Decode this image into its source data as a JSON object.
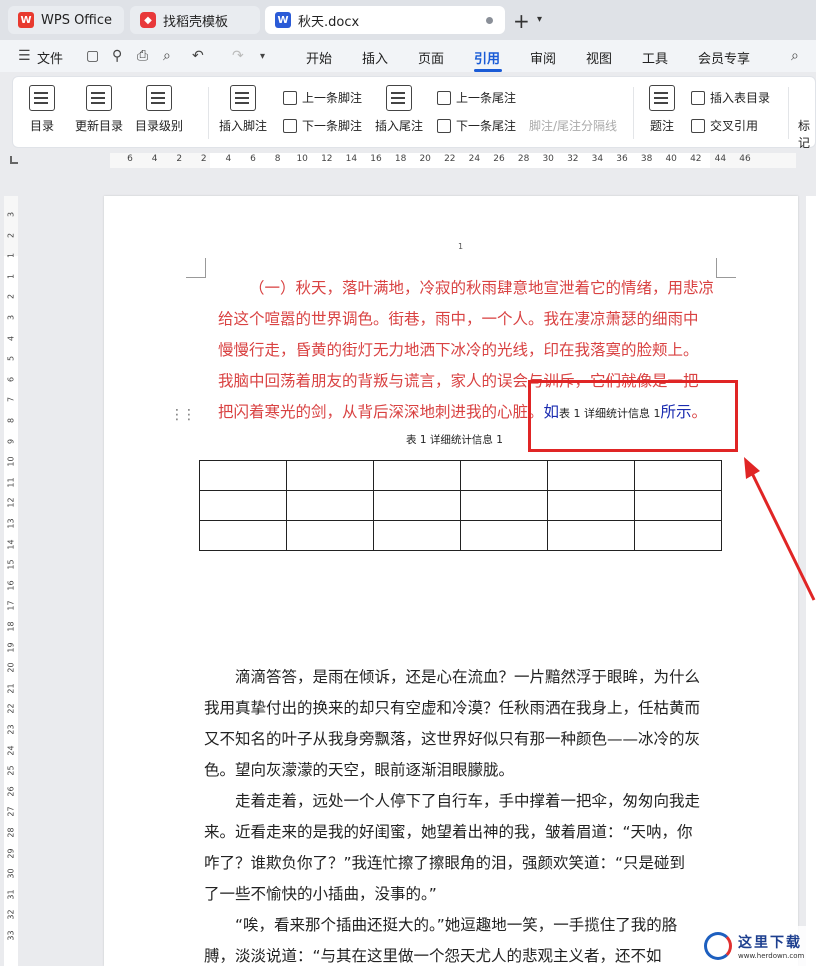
{
  "tabs": [
    {
      "label": "WPS Office",
      "icon": "wps-logo-icon"
    },
    {
      "label": "找稻壳模板",
      "icon": "daoke-logo-icon"
    },
    {
      "label": "秋天.docx",
      "icon": "word-doc-icon"
    }
  ],
  "menu": [
    "文件",
    "开始",
    "插入",
    "页面",
    "引用",
    "审阅",
    "视图",
    "工具",
    "会员专享"
  ],
  "active_menu": "引用",
  "ribbon": {
    "toc": "目录",
    "update_toc": "更新目录",
    "toc_level": "目录级别",
    "insert_footnote": "插入脚注",
    "prev_footnote": "上一条脚注",
    "next_footnote": "下一条脚注",
    "insert_endnote": "插入尾注",
    "prev_endnote": "上一条尾注",
    "next_endnote": "下一条尾注",
    "footnote_separator": "脚注/尾注分隔线",
    "caption": "题注",
    "insert_table_of_figures": "插入表目录",
    "cross_reference": "交叉引用",
    "mark_partial": "标记"
  },
  "hruler_numbers": [
    "6",
    "4",
    "2",
    "2",
    "4",
    "6",
    "8",
    "10",
    "12",
    "14",
    "16",
    "18",
    "20",
    "22",
    "24",
    "26",
    "28",
    "30",
    "32",
    "34",
    "36",
    "38",
    "40",
    "42",
    "44",
    "46"
  ],
  "vruler_numbers": [
    "3",
    "2",
    "1",
    "1",
    "2",
    "3",
    "4",
    "5",
    "6",
    "7",
    "8",
    "9",
    "10",
    "11",
    "12",
    "13",
    "14",
    "15",
    "16",
    "17",
    "18",
    "19",
    "20",
    "21",
    "22",
    "23",
    "24",
    "25",
    "26",
    "27",
    "28",
    "29",
    "30",
    "31",
    "32",
    "33"
  ],
  "page_number": "1",
  "red_para": [
    "（一）秋天，落叶满地，冷寂的秋雨肆意地宣泄着它的情绪，用悲凉",
    "给这个喧嚣的世界调色。街巷，雨中，一个人。我在凄凉萧瑟的细雨中",
    "慢慢行走，昏黄的街灯无力地洒下冰冷的光线，印在我落寞的脸颊上。",
    "我脑中回荡着朋友的背叛与谎言，家人的误会与训斥，它们就像是一把",
    "把闪着寒光的剑，从背后深深地刺进我的心脏。"
  ],
  "inline_ref": {
    "pre": "如",
    "caption": "表 1 详细统计信息  1",
    "post": "所示",
    "end": "。"
  },
  "table_caption": "表 1 详细统计信息 1",
  "body_paras": [
    "滴滴答答，是雨在倾诉，还是心在流血？一片黯然浮于眼眸，为什么",
    "我用真挚付出的换来的却只有空虚和冷漠？任秋雨洒在我身上，任枯黄而",
    "又不知名的叶子从我身旁飘落，这世界好似只有那一种颜色——冰冷的灰",
    "色。望向灰濛濛的天空，眼前逐渐泪眼朦胧。",
    "走着走着，远处一个人停下了自行车，手中撑着一把伞，匆匆向我走",
    "来。近看走来的是我的好闺蜜，她望着出神的我，皱着眉道：“天呐，你",
    "咋了？谁欺负你了？”我连忙擦了擦眼角的泪，强颜欢笑道：“只是碰到",
    "了一些不愉快的小插曲，没事的。”",
    "“唉，看来那个插曲还挺大的。”她逗趣地一笑，一手揽住了我的胳",
    "膊，淡淡说道：“与其在这里做一个怨天尤人的悲观主义者，还不如"
  ],
  "watermark": {
    "cn": "这里下载",
    "url": "www.herdown.com"
  }
}
